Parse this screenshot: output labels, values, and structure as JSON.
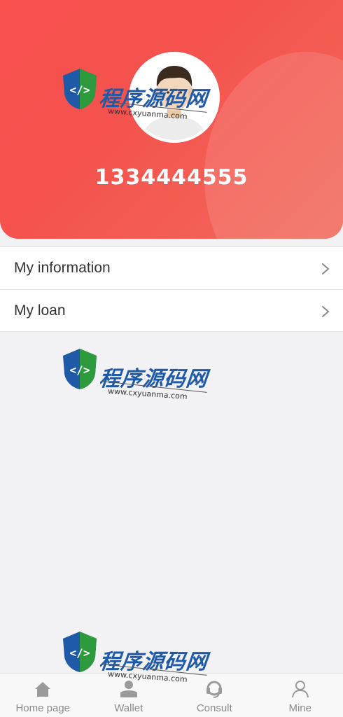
{
  "profile": {
    "phone": "1334444555"
  },
  "menu": {
    "items": [
      {
        "label": "My information"
      },
      {
        "label": "My loan"
      }
    ]
  },
  "watermark": {
    "cn_text": "程序源码网",
    "url": "www.cxyuanma.com"
  },
  "tabbar": {
    "items": [
      {
        "label": "Home page",
        "icon": "home-icon"
      },
      {
        "label": "Wallet",
        "icon": "wallet-icon"
      },
      {
        "label": "Consult",
        "icon": "headset-icon"
      },
      {
        "label": "Mine",
        "icon": "user-icon"
      }
    ]
  },
  "colors": {
    "header_red": "#f5524d",
    "watermark_blue": "#1f5aa8",
    "tab_gray": "#8a8a8a"
  }
}
